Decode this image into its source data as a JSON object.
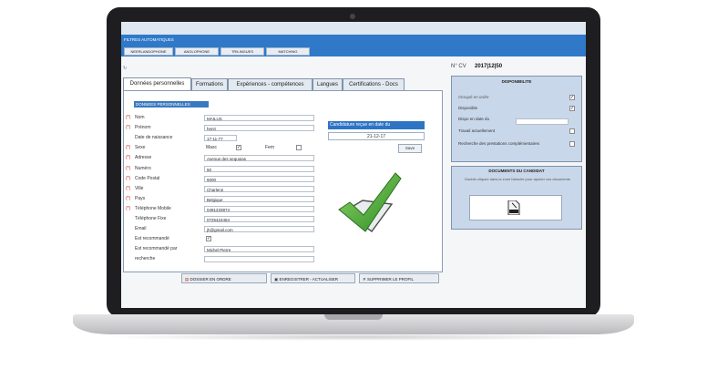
{
  "filters": {
    "title": "FILTRES AUTOMATIQUES",
    "buttons": [
      "NEERLANDOPHONE",
      "ANGLOPHONE",
      "TRILINGUES",
      "MATCHING"
    ]
  },
  "cv": {
    "label": "N° CV",
    "value": "2017|12|50"
  },
  "tabs": [
    "Données personnelles",
    "Formations",
    "Expériences - compétences",
    "Langues",
    "Certifications - Docs"
  ],
  "personal": {
    "section_title": "DONNEES PERSONNELLES",
    "labels": [
      "Nom",
      "Prénom",
      "Date de naissance",
      "Sexe",
      "Adresse",
      "Numéro",
      "Code Postal",
      "Ville",
      "Pays",
      "Téléphone Mobile",
      "Téléphone Fixe",
      "Email",
      "Est recommandé",
      "Est recommandé par",
      "recherche"
    ],
    "values": [
      "MAILUS",
      "henri",
      "17-11-77",
      "",
      "Avenue des sequoias",
      "50",
      "6000",
      "Charleroi",
      "Belgique",
      "0491233874",
      "0725424454",
      "jh@gmail.com",
      "",
      "Michel Pierre",
      ""
    ],
    "sexe_masc_label": "Masc",
    "sexe_fem_label": "Fem",
    "required_mark": "(*)"
  },
  "candidature": {
    "title": "Candidature reçue en date du",
    "date": "21-12-17",
    "save_label": "Save"
  },
  "actions": {
    "dossier": "DOSSIER EN ORDRE",
    "enregistrer": "ENREGISTRER - ACTUALISER",
    "supprimer": "SUPPRIMER LE PROFIL"
  },
  "disponibilite": {
    "title": "DISPONIBILITE",
    "items": [
      "Occupé en ordre",
      "Disponible",
      "Dispo en date du",
      "Travail actuellement",
      "Recherche des prestations complémentaires"
    ],
    "checked": [
      true,
      true,
      false,
      false,
      false
    ]
  },
  "documents": {
    "title": "DOCUMENTS DU CANDIDAT",
    "hint": "Double-cliquez dans la zone blanche pour ajouter vos documents",
    "file_icon": "pdf-file-icon"
  },
  "colors": {
    "accent": "#2f79c8",
    "check": "#3c9b2e"
  }
}
